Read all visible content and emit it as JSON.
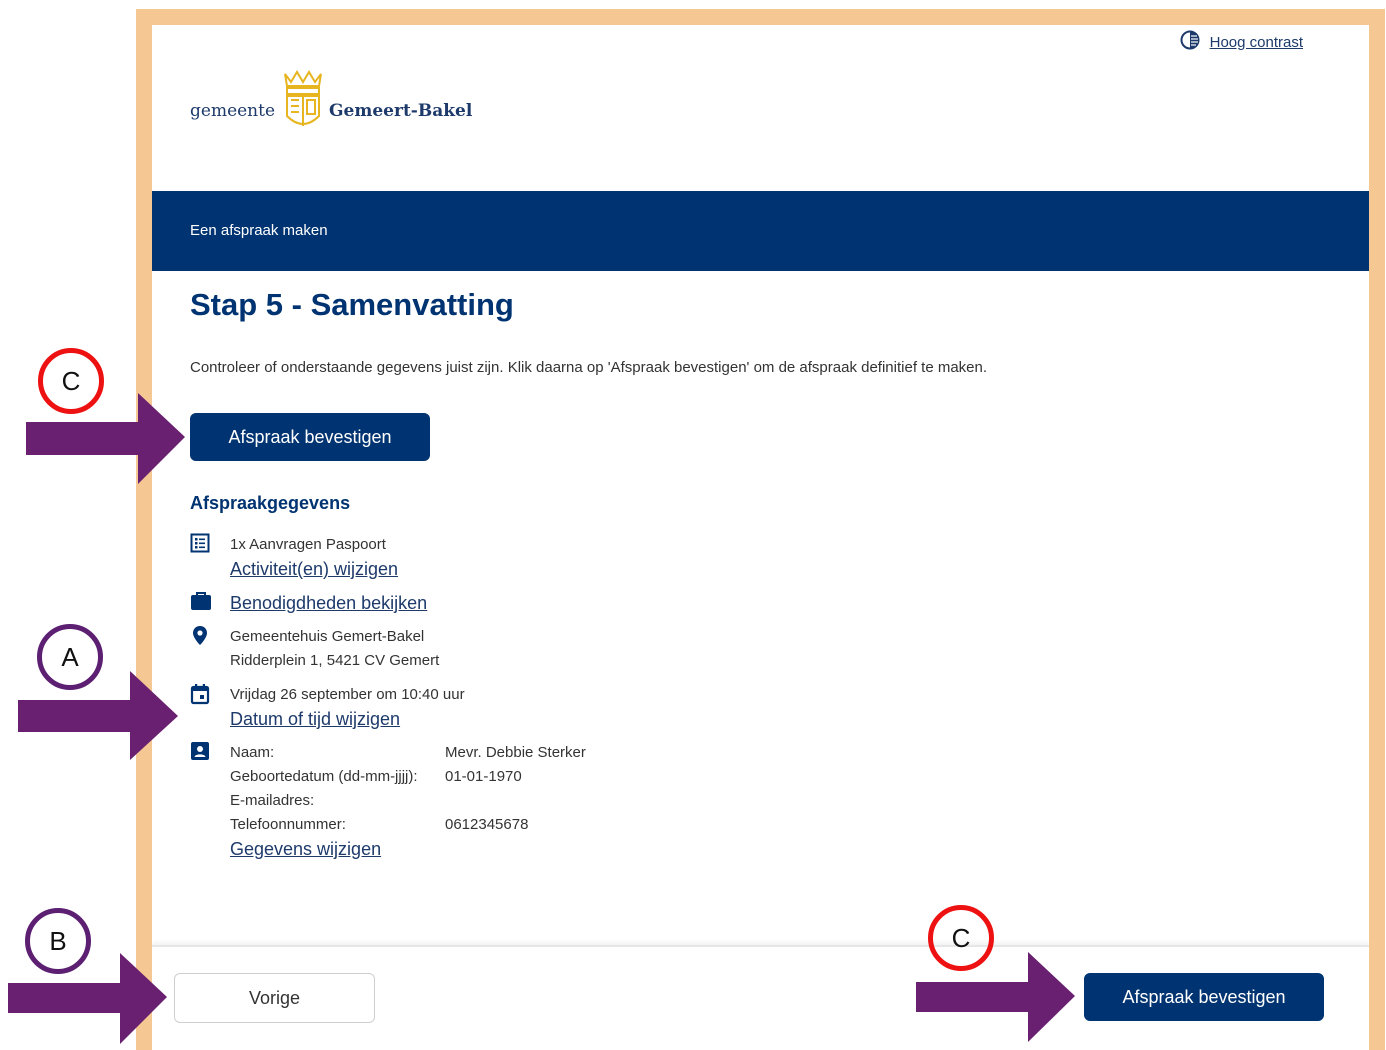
{
  "header": {
    "contrast_link": "Hoog contrast",
    "logo_prefix": "gemeente",
    "logo_name": "Gemeert-Bakel"
  },
  "banner": {
    "title": "Een afspraak maken"
  },
  "main": {
    "step_title": "Stap 5 - Samenvatting",
    "intro": "Controleer of onderstaande gegevens juist zijn. Klik daarna op 'Afspraak bevestigen' om de afspraak definitief te maken.",
    "confirm_label": "Afspraak bevestigen",
    "section_title": "Afspraakgegevens",
    "activity": "1x Aanvragen Paspoort",
    "activity_link": "Activiteit(en) wijzigen",
    "requirements_link": "Benodigdheden bekijken",
    "location_name": "Gemeentehuis Gemert-Bakel",
    "location_address": "Ridderplein 1, 5421 CV Gemert",
    "datetime": "Vrijdag 26 september om 10:40 uur",
    "datetime_link": "Datum of tijd wijzigen",
    "personal": {
      "name_label": "Naam:",
      "name_value": "Mevr. Debbie Sterker",
      "dob_label": "Geboortedatum (dd-mm-jjjj):",
      "dob_value": "01-01-1970",
      "email_label": "E-mailadres:",
      "email_value": "",
      "phone_label": "Telefoonnummer:",
      "phone_value": "0612345678"
    },
    "personal_link": "Gegevens wijzigen"
  },
  "footer": {
    "prev_label": "Vorige",
    "confirm_label": "Afspraak bevestigen"
  },
  "annotations": {
    "c_top": "C",
    "a": "A",
    "b": "B",
    "c_bottom": "C"
  },
  "colors": {
    "frame": "#f5c893",
    "primary": "#003371",
    "arrow": "#6a2070",
    "circle_red": "#ee1111",
    "circle_purple": "#5c1f72"
  }
}
